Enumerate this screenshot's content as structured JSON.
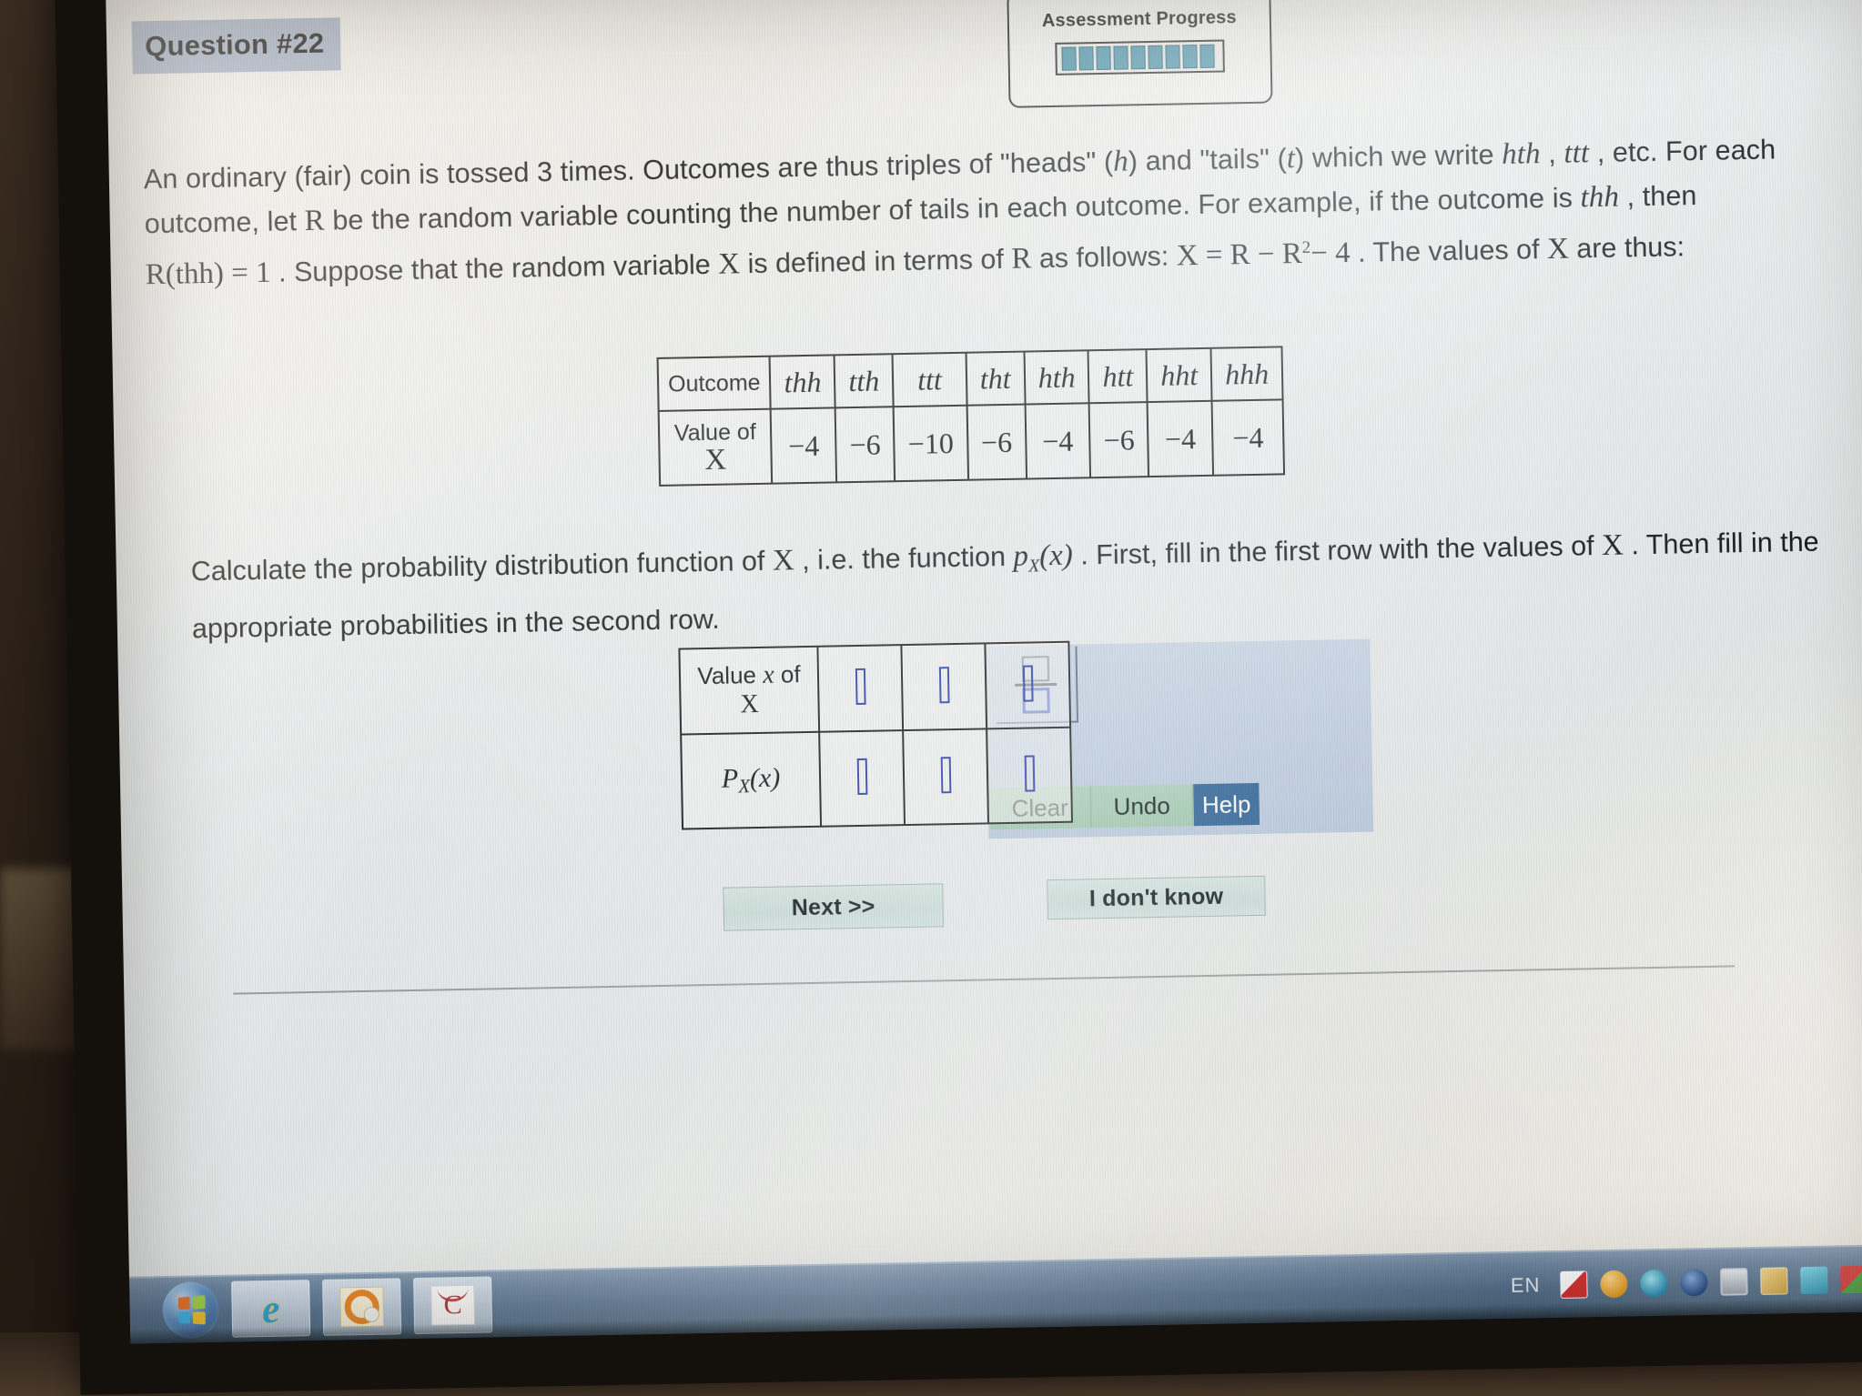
{
  "header": {
    "question_label": "Question #22"
  },
  "progress": {
    "title": "Assessment Progress",
    "segments_filled": 9,
    "bar_color": "#4e93a8"
  },
  "question": {
    "paragraph_1_a": "An ordinary (fair) coin is tossed 3 times. Outcomes are thus triples of \"heads\" (",
    "var_h": "h",
    "paragraph_1_b": ") and \"tails\" (",
    "var_t": "t",
    "paragraph_1_c": ") which we write ",
    "ex_hth": "hth",
    "paragraph_1_d": " , ",
    "ex_ttt": "ttt",
    "paragraph_1_e": " , etc. For each outcome, let ",
    "var_R": "R",
    "paragraph_1_f": " be the random variable counting the number of tails in each outcome. For example, if the outcome is ",
    "ex_thh": "thh",
    "paragraph_1_g": " , then",
    "paragraph_2_a": "R(thh)",
    "paragraph_2_eq": " = 1",
    "paragraph_2_b": " . Suppose that the random variable ",
    "var_X": "X",
    "paragraph_2_c": " is defined in terms of ",
    "paragraph_2_d": " as follows: ",
    "formula_x": "X = R − R",
    "formula_exp": "2",
    "formula_tail": "− 4",
    "paragraph_2_e": " . The values of ",
    "paragraph_2_f": " are thus:"
  },
  "outcome_table": {
    "row_labels": [
      "Outcome",
      "Value of X"
    ],
    "value_label_line1": "Value of",
    "value_label_line2": "X",
    "outcomes": [
      "thh",
      "tth",
      "ttt",
      "tht",
      "hth",
      "htt",
      "hht",
      "hhh"
    ],
    "values": [
      "−4",
      "−6",
      "−10",
      "−6",
      "−4",
      "−6",
      "−4",
      "−4"
    ]
  },
  "instruction": {
    "part_a": "Calculate the probability distribution function of ",
    "var_X": "X",
    "part_b": " , i.e. the function ",
    "pfunc_p": "p",
    "pfunc_sub": "X",
    "pfunc_arg": "(x)",
    "part_c": " . First, fill in the first row with the values of ",
    "part_d": " . Then fill in the appropriate probabilities in the second row."
  },
  "answer_table": {
    "row1_label_prefix": "Value ",
    "row1_label_x": "x",
    "row1_label_mid": " of ",
    "row1_label_X": "X",
    "row2_label_p": "P",
    "row2_label_sub": "X",
    "row2_label_arg": "(x)",
    "row1_inputs": [
      "",
      "",
      ""
    ],
    "row2_inputs": [
      "",
      "",
      ""
    ],
    "input_placeholder": ""
  },
  "toolbar": {
    "fraction_template": "fraction",
    "clear_label": "Clear",
    "undo_label": "Undo",
    "help_label": "Help",
    "help_bg": "#2a5f93",
    "tool_bg": "#9dc5ab"
  },
  "nav": {
    "next_label": "Next >>",
    "dont_know_label": "I don't know"
  },
  "taskbar": {
    "start_name": "windows-start-orb",
    "items": [
      {
        "name": "internet-explorer",
        "glyph": "e"
      },
      {
        "name": "office-app",
        "glyph": ""
      },
      {
        "name": "chegg-app",
        "glyph": "C"
      }
    ],
    "tray_language": "EN",
    "tray_icons": [
      "antivirus-icon",
      "update-icon",
      "sync-icon",
      "browser-icon",
      "display-icon",
      "media-icon",
      "cloud-icon",
      "network-share-icon",
      "power-icon"
    ]
  }
}
